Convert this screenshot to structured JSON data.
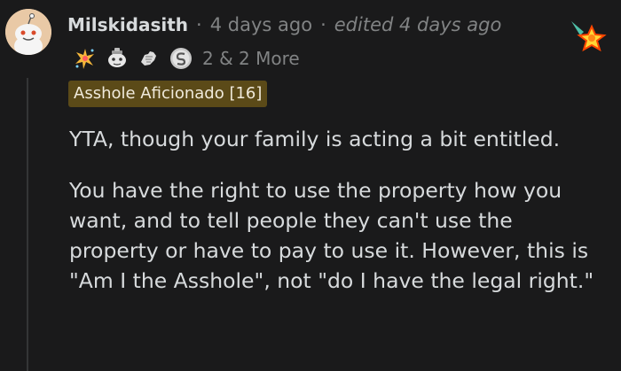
{
  "comment": {
    "username": "Milskidasith",
    "posted": "4 days ago",
    "edited": "edited 4 days ago",
    "separator": "·",
    "awards_more": "2 & 2 More",
    "flair": "Asshole Aficionado [16]",
    "paragraphs": [
      "YTA, though your family is acting a bit entitled.",
      "You have the right to use the property how you want, and to tell people they can't use the property or have to pay to use it. However, this is \"Am I the Asshole\", not \"do I have the legal right.\""
    ],
    "award_icons": [
      "sparkle-burst-icon",
      "snoo-helper-icon",
      "fist-bump-icon",
      "silver-coin-icon"
    ],
    "badge_icon": "shooting-star-icon",
    "colors": {
      "background": "#1a1a1b",
      "text": "#d7dadc",
      "meta": "#818384",
      "flair_bg": "#5b4a18"
    }
  }
}
